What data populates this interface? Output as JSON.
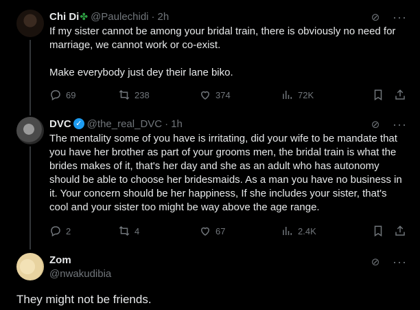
{
  "tweets": [
    {
      "name": "Chi Di",
      "handle": "@Paulechidi",
      "time": "2h",
      "text1": "If my sister cannot be among your bridal train, there is obviously no need for marriage, we cannot work or co-exist.",
      "text2": "Make everybody just dey their lane biko.",
      "replies": "69",
      "reposts": "238",
      "likes": "374",
      "views": "72K"
    },
    {
      "name": "DVC",
      "handle": "@the_real_DVC",
      "time": "1h",
      "text": "The mentality some of you have is irritating, did your wife to be mandate that you have her brother as part of your grooms men, the bridal train is what the brides makes of it, that's her day and she as an adult who has autonomy should be able to choose her bridesmaids. As a man you have no business in it. Your concern should be her happiness, If she includes your sister, that's cool and your sister too might be way above the age range.",
      "replies": "2",
      "reposts": "4",
      "likes": "67",
      "views": "2.4K"
    }
  ],
  "main": {
    "name": "Zom",
    "handle": "@nwakudibia",
    "text": "They might not be friends."
  },
  "separator": "·",
  "icons": {
    "reply": "reply-icon",
    "repost": "repost-icon",
    "like": "like-icon",
    "views": "views-icon",
    "bookmark": "bookmark-icon",
    "share": "share-icon",
    "grok": "grok-icon",
    "more": "more-icon"
  },
  "colors": {
    "background": "#000000",
    "text": "#e7e9ea",
    "muted": "#71767b",
    "verified": "#1d9bf0"
  }
}
